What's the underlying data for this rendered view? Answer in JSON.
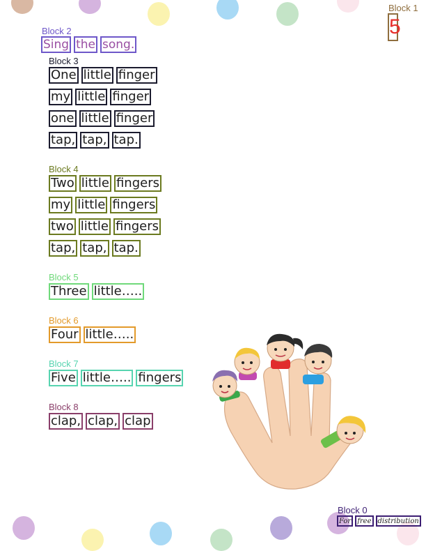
{
  "blocks": {
    "b1": {
      "label": "Block 1",
      "page_number": "5"
    },
    "b2": {
      "label": "Block 2",
      "words": [
        "Sing",
        "the",
        "song."
      ]
    },
    "b3": {
      "label": "Block 3",
      "lines": [
        [
          "One",
          "little",
          "finger"
        ],
        [
          "my",
          "little",
          "finger"
        ],
        [
          "one",
          "little",
          "finger"
        ],
        [
          "tap,",
          "tap,",
          "tap."
        ]
      ]
    },
    "b4": {
      "label": "Block 4",
      "lines": [
        [
          "Two",
          "little",
          "fingers"
        ],
        [
          "my",
          "little",
          "fingers"
        ],
        [
          "two",
          "little",
          "fingers"
        ],
        [
          "tap,",
          "tap,",
          "tap."
        ]
      ]
    },
    "b5": {
      "label": "Block 5",
      "words": [
        "Three",
        "little….."
      ]
    },
    "b6": {
      "label": "Block 6",
      "words": [
        "Four",
        "little….."
      ]
    },
    "b7": {
      "label": "Block 7",
      "words": [
        "Five",
        "little…..",
        "fingers"
      ]
    },
    "b8": {
      "label": "Block 8",
      "words": [
        "clap,",
        "clap,",
        "clap"
      ]
    },
    "b0": {
      "label": "Block 0",
      "words": [
        "For",
        "free",
        "distribution"
      ]
    }
  },
  "colors": {
    "b1": "#8f6e3e",
    "b2": "#6e57c9",
    "b3": "#1b1b2e",
    "b4": "#6b7a1f",
    "b5": "#6fd97a",
    "b6": "#e39a2a",
    "b7": "#57d4b0",
    "b8": "#8a3f6a",
    "b0": "#3c1e73",
    "page_number": "#e8302c"
  },
  "illustration": {
    "name": "hand-with-five-finger-puppets-icon"
  }
}
